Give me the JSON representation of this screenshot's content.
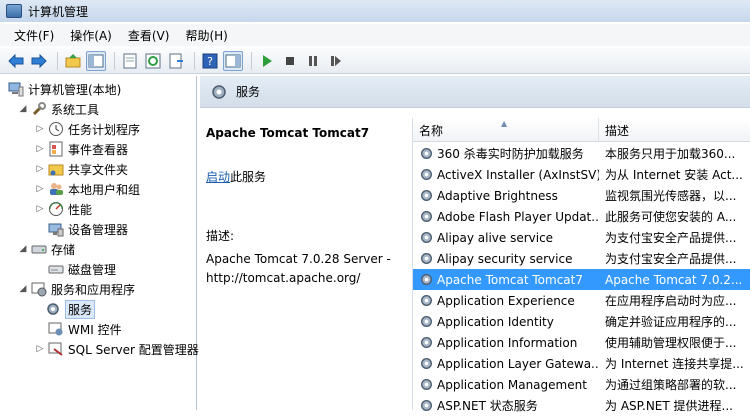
{
  "window": {
    "title": "计算机管理"
  },
  "menu": [
    "文件(F)",
    "操作(A)",
    "查看(V)",
    "帮助(H)"
  ],
  "toolbar": {
    "buttons": [
      "back-icon",
      "forward-icon",
      "up-folder-icon",
      "show-tree-icon",
      "properties-icon",
      "refresh-icon",
      "export-icon",
      "help-icon",
      "view-icon",
      "play-icon",
      "stop-icon",
      "pause-icon",
      "restart-icon"
    ]
  },
  "tree": {
    "root": "计算机管理(本地)",
    "system_tools": "系统工具",
    "task_scheduler": "任务计划程序",
    "event_viewer": "事件查看器",
    "shared_folders": "共享文件夹",
    "local_users": "本地用户和组",
    "performance": "性能",
    "device_manager": "设备管理器",
    "storage": "存储",
    "disk_management": "磁盘管理",
    "services_apps": "服务和应用程序",
    "services": "服务",
    "wmi": "WMI 控件",
    "sql_server": "SQL Server 配置管理器"
  },
  "header": {
    "title": "服务"
  },
  "detail": {
    "title": "Apache Tomcat Tomcat7",
    "action_link": "启动",
    "action_suffix": "此服务",
    "desc_label": "描述:",
    "desc_line1": "Apache Tomcat 7.0.28 Server -",
    "desc_line2": "http://tomcat.apache.org/"
  },
  "list": {
    "col_name": "名称",
    "col_desc": "描述",
    "rows": [
      {
        "name": "360 杀毒实时防护加载服务",
        "desc": "本服务只用于加载360..."
      },
      {
        "name": "ActiveX Installer (AxInstSV)",
        "desc": "为从 Internet 安装 Act..."
      },
      {
        "name": "Adaptive Brightness",
        "desc": "监视氛围光传感器，以..."
      },
      {
        "name": "Adobe Flash Player Updat...",
        "desc": "此服务可使您安装的 A..."
      },
      {
        "name": "Alipay alive service",
        "desc": "为支付宝安全产品提供..."
      },
      {
        "name": "Alipay security service",
        "desc": "为支付宝安全产品提供..."
      },
      {
        "name": "Apache Tomcat Tomcat7",
        "desc": "Apache Tomcat 7.0.2..."
      },
      {
        "name": "Application Experience",
        "desc": "在应用程序启动时为应..."
      },
      {
        "name": "Application Identity",
        "desc": "确定并验证应用程序的..."
      },
      {
        "name": "Application Information",
        "desc": "使用辅助管理权限便于..."
      },
      {
        "name": "Application Layer Gatewa...",
        "desc": "为 Internet 连接共享提..."
      },
      {
        "name": "Application Management",
        "desc": "为通过组策略部署的软..."
      },
      {
        "name": "ASP.NET 状态服务",
        "desc": "为 ASP.NET 提供进程..."
      }
    ]
  }
}
